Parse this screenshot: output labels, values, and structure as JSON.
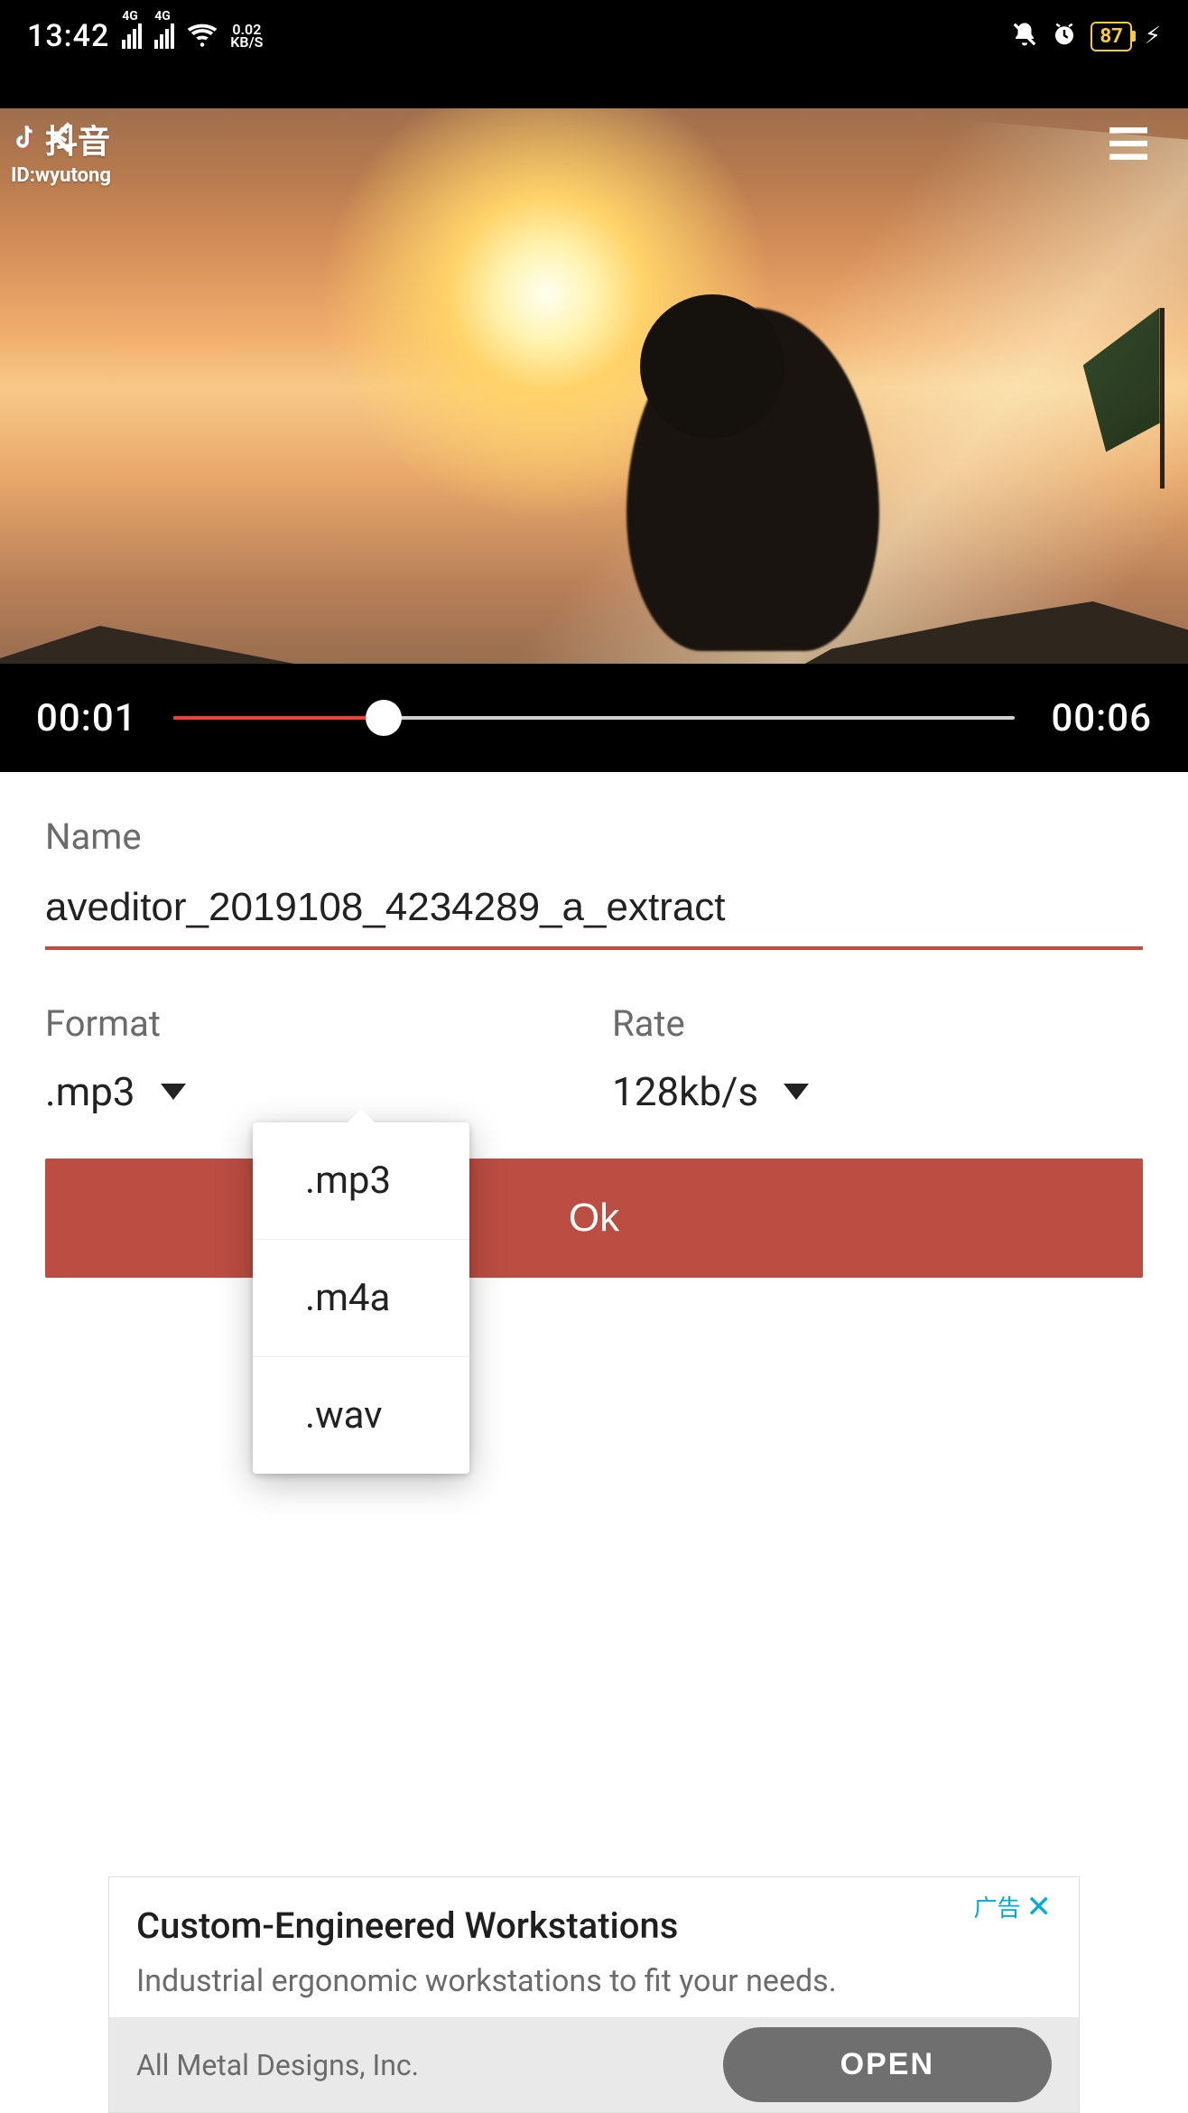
{
  "status": {
    "time": "13:42",
    "net_label": "4G",
    "speed_top": "0.02",
    "speed_bot": "KB/S",
    "battery": "87"
  },
  "video": {
    "watermark_name": "抖音",
    "watermark_id": "ID:wyutong",
    "elapsed": "00:01",
    "duration": "00:06"
  },
  "form": {
    "name_label": "Name",
    "name_value": "aveditor_2019108_4234289_a_extract",
    "format_label": "Format",
    "format_value": ".mp3",
    "rate_label": "Rate",
    "rate_value": "128kb/s",
    "ok_label": "Ok",
    "format_options": [
      ".mp3",
      ".m4a",
      ".wav"
    ]
  },
  "ad": {
    "tag": "广告",
    "title": "Custom-Engineered Workstations",
    "subtitle": "Industrial ergonomic workstations to fit your needs.",
    "company": "All Metal Designs, Inc.",
    "open": "OPEN"
  }
}
